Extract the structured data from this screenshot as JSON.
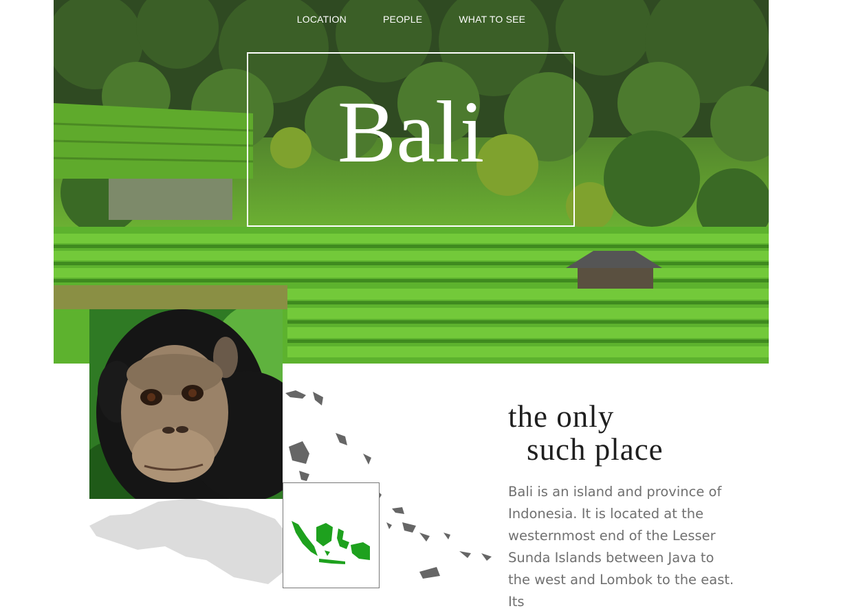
{
  "nav": {
    "items": [
      "LOCATION",
      "PEOPLE",
      "WHAT TO SEE"
    ]
  },
  "hero": {
    "title": "Bali"
  },
  "section": {
    "heading_line1": "the only",
    "heading_line2": "such place",
    "body": "Bali is an island and province of Indonesia. It is located at the westernmost end of the Lesser Sunda Islands between Java to the west and Lombok to the east. Its"
  },
  "colors": {
    "map_highlight": "#1ea11e",
    "map_dark": "#666666",
    "map_light": "#dcdcdc",
    "text_body": "#707070"
  }
}
